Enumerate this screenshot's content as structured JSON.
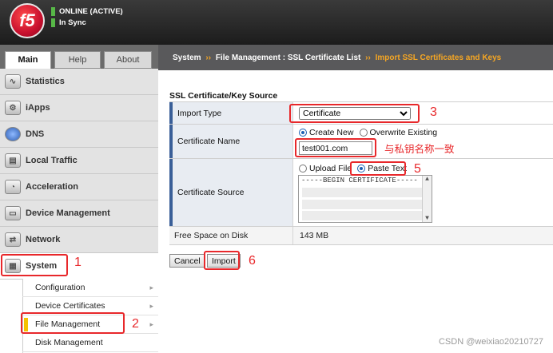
{
  "header": {
    "logo_text": "f5",
    "status_line1": "ONLINE (ACTIVE)",
    "status_line2": "In Sync"
  },
  "tabs": [
    "Main",
    "Help",
    "About"
  ],
  "breadcrumb": {
    "root": "System",
    "sep1": "››",
    "mid": "File Management : SSL Certificate List",
    "sep2": "››",
    "current": "Import SSL Certificates and Keys"
  },
  "nav": {
    "items": [
      "Statistics",
      "iApps",
      "DNS",
      "Local Traffic",
      "Acceleration",
      "Device Management",
      "Network",
      "System"
    ]
  },
  "subnav": {
    "items": [
      "Configuration",
      "Device Certificates",
      "File Management",
      "Disk Management"
    ]
  },
  "form": {
    "section_title": "SSL Certificate/Key Source",
    "import_type_label": "Import Type",
    "import_type_value": "Certificate",
    "cert_name_label": "Certificate Name",
    "create_new": "Create New",
    "overwrite_existing": "Overwrite Existing",
    "cert_name_value": "test001.com",
    "cert_source_label": "Certificate Source",
    "upload_file": "Upload File",
    "paste_text": "Paste Text",
    "pem_text": "-----BEGIN CERTIFICATE-----",
    "free_space_label": "Free Space on Disk",
    "free_space_value": "143 MB",
    "cancel": "Cancel",
    "import": "Import"
  },
  "annotations": {
    "n1": "1",
    "n2": "2",
    "n3": "3",
    "n5": "5",
    "n6": "6",
    "name_note": "与私钥名称一致",
    "color": "#e8282b"
  },
  "watermark": "CSDN @weixiao20210727"
}
